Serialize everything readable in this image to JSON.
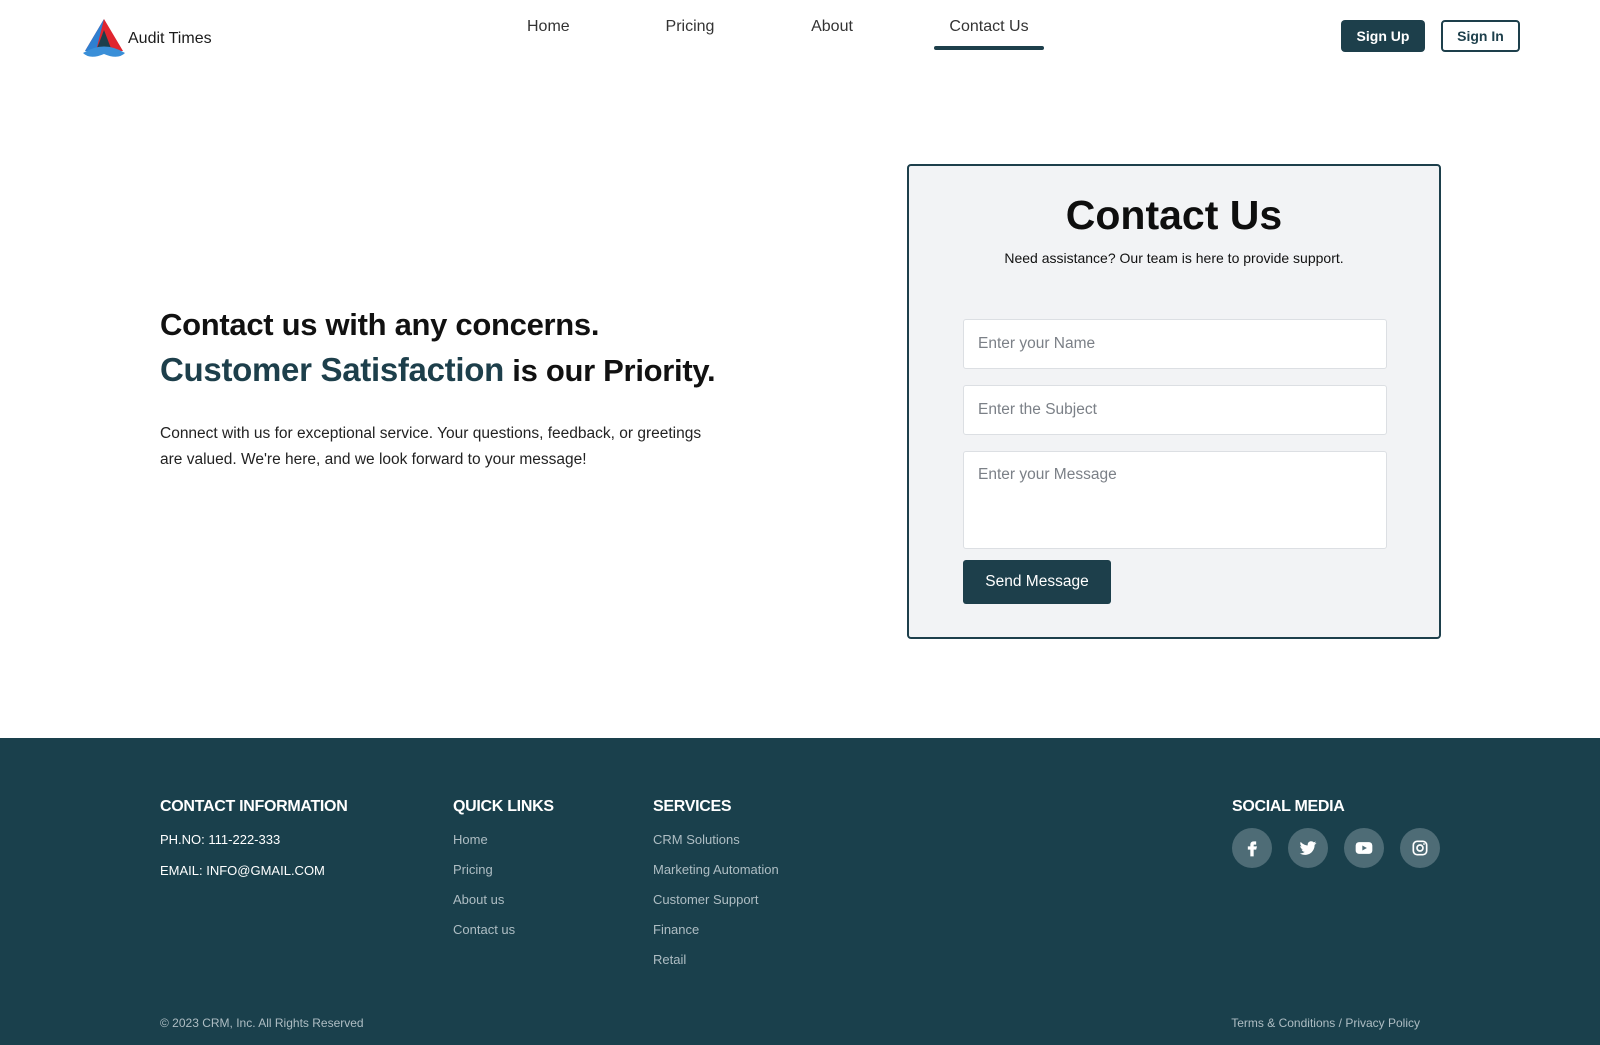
{
  "header": {
    "brand_name": "Audit Times",
    "nav": [
      {
        "label": "Home"
      },
      {
        "label": "Pricing"
      },
      {
        "label": "About"
      },
      {
        "label": "Contact Us"
      }
    ],
    "active_nav": "Contact Us",
    "signup_label": "Sign Up",
    "signin_label": "Sign In"
  },
  "hero": {
    "headline_part1": "Contact us with any concerns. ",
    "headline_highlight": "Customer Satisfaction",
    "headline_part2": " is our Priority.",
    "body": "Connect with us for exceptional service. Your questions, feedback, or greetings are valued. We're here, and we look forward to your message!"
  },
  "form": {
    "title": "Contact Us",
    "subtitle": "Need assistance? Our team is here to provide support.",
    "name_placeholder": "Enter your Name",
    "subject_placeholder": "Enter the Subject",
    "message_placeholder": "Enter your Message",
    "send_label": "Send Message"
  },
  "footer": {
    "contact": {
      "heading": "CONTACT INFORMATION",
      "phone": "PH.NO: 111-222-333",
      "email": "EMAIL: INFO@GMAIL.COM"
    },
    "quick_links": {
      "heading": "QUICK LINKS",
      "items": [
        "Home",
        "Pricing",
        "About us",
        "Contact us"
      ]
    },
    "services": {
      "heading": "SERVICES",
      "items": [
        "CRM Solutions",
        "Marketing Automation",
        "Customer Support",
        "Finance",
        "Retail"
      ]
    },
    "social": {
      "heading": "SOCIAL MEDIA",
      "icons": [
        "facebook-icon",
        "twitter-icon",
        "youtube-icon",
        "instagram-icon"
      ]
    },
    "copyright": "© 2023 CRM, Inc. All Rights Reserved",
    "terms": "Terms & Conditions",
    "separator": " / ",
    "privacy": "Privacy Policy"
  },
  "colors": {
    "primary": "#1d3f4b",
    "footer_bg": "#1a404c",
    "card_bg": "#f2f3f5",
    "logo_red": "#e0252f",
    "logo_blue": "#2e7fd1"
  }
}
